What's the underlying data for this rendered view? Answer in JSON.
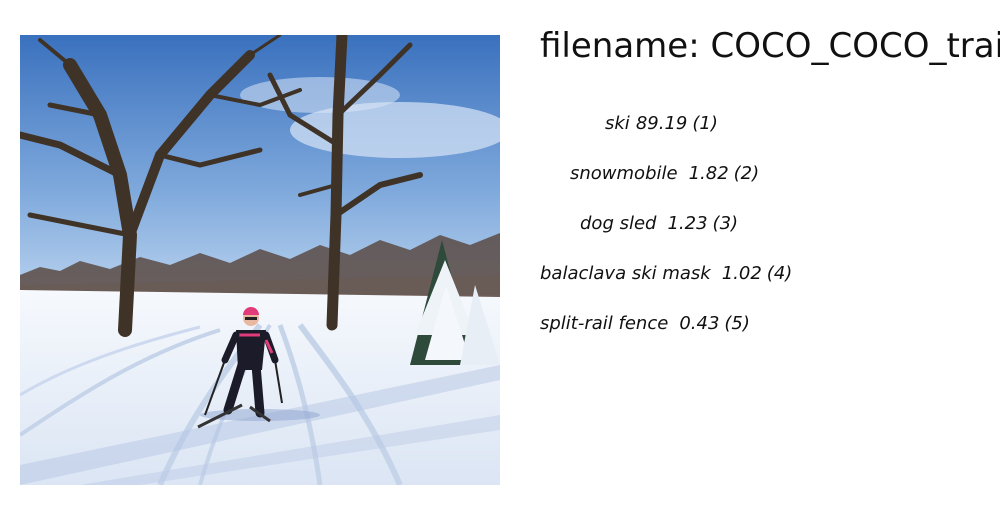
{
  "header": {
    "filename_text": "filename: COCO_COCO_train"
  },
  "predictions": [
    {
      "label": "ski",
      "score": "89.19",
      "rank": "(1)",
      "indent": "ind-1"
    },
    {
      "label": "snowmobile",
      "score": "1.82",
      "rank": "(2)",
      "indent": "ind-2"
    },
    {
      "label": "dog sled",
      "score": "1.23",
      "rank": "(3)",
      "indent": "ind-3"
    },
    {
      "label": "balaclava ski mask",
      "score": "1.02",
      "rank": "(4)",
      "indent": "ind-4"
    },
    {
      "label": "split-rail fence",
      "score": "0.43",
      "rank": "(5)",
      "indent": "ind-5"
    }
  ],
  "colors": {
    "sky_top": "#3f78c4",
    "sky_bottom": "#9ec3ea",
    "snow": "#f2f6fb",
    "shadow": "#b9c9e6",
    "tree_trunk": "#4a3a2c",
    "skier_jacket": "#1b1b2a",
    "skier_accent": "#e23b7a"
  }
}
